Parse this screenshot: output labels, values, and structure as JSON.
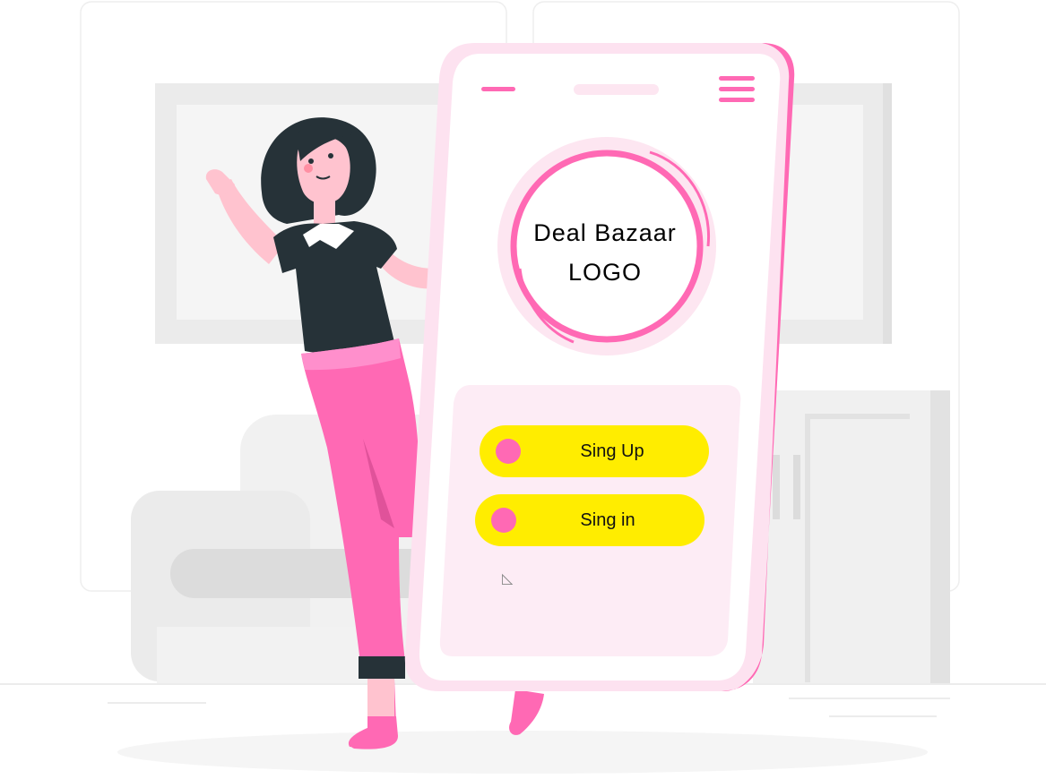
{
  "logo": {
    "line1": "Deal Bazaar",
    "line2": "LOGO"
  },
  "buttons": {
    "signup_label": "Sing Up",
    "signin_label": "Sing in"
  },
  "colors": {
    "accent_pink": "#ff69b4",
    "button_yellow": "#ffed00",
    "panel_pink": "#fdecf5"
  },
  "icons": {
    "menu": "hamburger-icon",
    "cursor": "cursor-icon"
  }
}
